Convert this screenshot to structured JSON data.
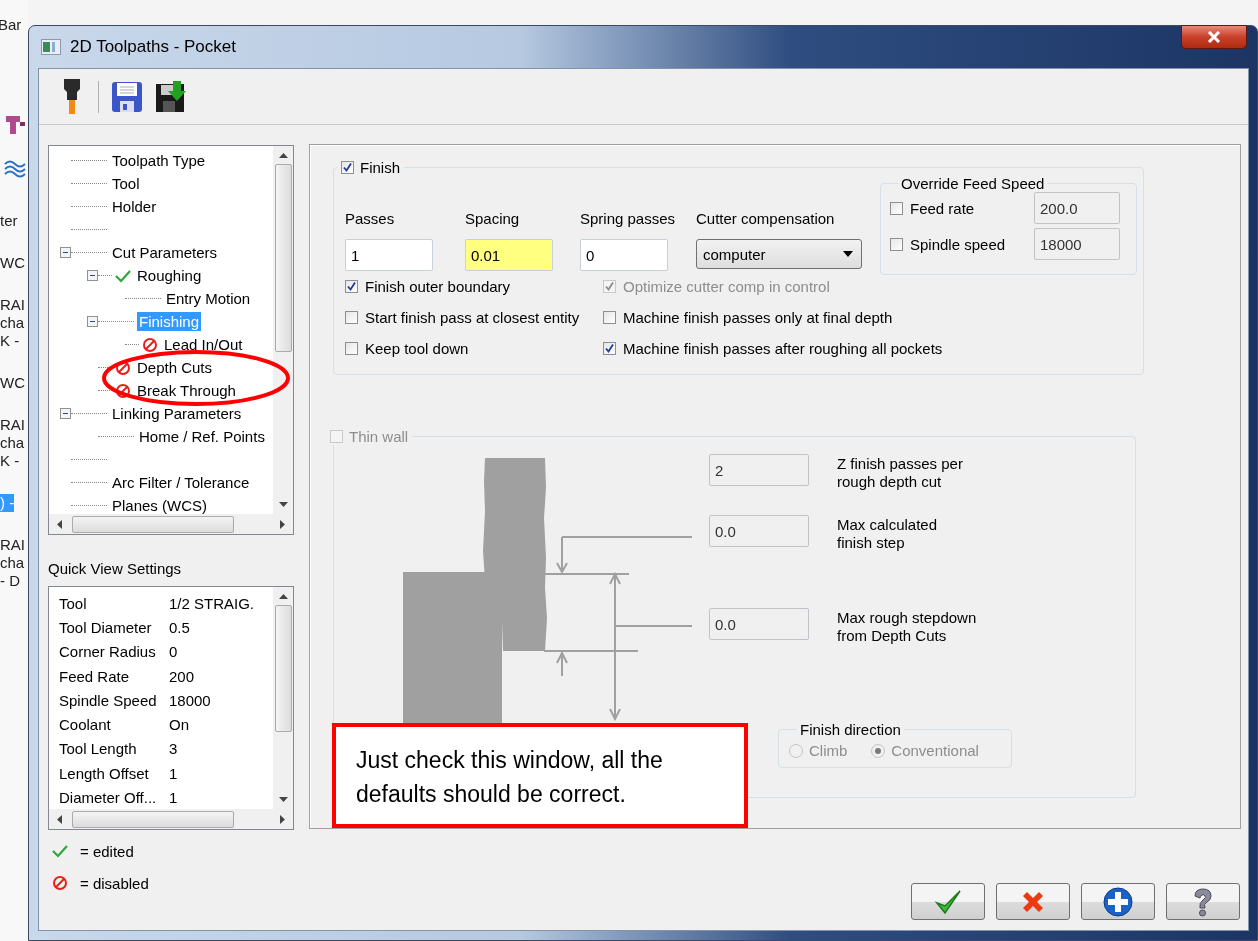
{
  "background_app": {
    "title_fragment": "Bar",
    "groups": [
      {
        "lines": [
          "ter"
        ],
        "selected": false
      },
      {
        "lines": [
          "WC"
        ],
        "selected": false
      },
      {
        "lines": [
          "RAI",
          "cha",
          "K -"
        ],
        "selected": false
      },
      {
        "lines": [
          "WC"
        ],
        "selected": false
      },
      {
        "lines": [
          "RAI",
          "cha",
          "K -"
        ],
        "selected": false
      },
      {
        "lines": [
          ") -"
        ],
        "selected": true
      },
      {
        "lines": [
          "RAI",
          "cha",
          "- D"
        ],
        "selected": false
      }
    ]
  },
  "window": {
    "title": "2D Toolpaths - Pocket"
  },
  "tree": {
    "items": [
      {
        "kind": "node",
        "label": "Toolpath Type",
        "selected": false,
        "edited": false,
        "disabled": false
      },
      {
        "kind": "node",
        "label": "Tool",
        "selected": false,
        "edited": false,
        "disabled": false
      },
      {
        "kind": "node",
        "label": "Holder",
        "selected": false,
        "edited": false,
        "disabled": false
      },
      {
        "kind": "spacer"
      },
      {
        "kind": "node",
        "label": "Cut Parameters",
        "selected": false,
        "edited": false,
        "disabled": false,
        "expanded": true,
        "children": [
          {
            "kind": "node",
            "label": "Roughing",
            "selected": false,
            "edited": true,
            "disabled": false,
            "expanded": true,
            "children": [
              {
                "kind": "node",
                "label": "Entry Motion",
                "selected": false,
                "edited": false,
                "disabled": false
              }
            ]
          },
          {
            "kind": "node",
            "label": "Finishing",
            "selected": true,
            "edited": false,
            "disabled": false,
            "expanded": true,
            "children": [
              {
                "kind": "node",
                "label": "Lead In/Out",
                "selected": false,
                "edited": false,
                "disabled": true
              }
            ]
          },
          {
            "kind": "node",
            "label": "Depth Cuts",
            "selected": false,
            "edited": false,
            "disabled": true
          },
          {
            "kind": "node",
            "label": "Break Through",
            "selected": false,
            "edited": false,
            "disabled": true
          }
        ]
      },
      {
        "kind": "node",
        "label": "Linking Parameters",
        "selected": false,
        "edited": false,
        "disabled": false,
        "expanded": true,
        "children": [
          {
            "kind": "node",
            "label": "Home / Ref. Points",
            "selected": false,
            "edited": false,
            "disabled": false
          }
        ]
      },
      {
        "kind": "spacer"
      },
      {
        "kind": "node",
        "label": "Arc Filter / Tolerance",
        "selected": false,
        "edited": false,
        "disabled": false
      },
      {
        "kind": "node",
        "label": "Planes (WCS)",
        "selected": false,
        "edited": false,
        "disabled": false
      }
    ]
  },
  "quick_view": {
    "title": "Quick View Settings",
    "rows": [
      {
        "label": "Tool",
        "value": "1/2 STRAIG."
      },
      {
        "label": "Tool Diameter",
        "value": "0.5"
      },
      {
        "label": "Corner Radius",
        "value": "0"
      },
      {
        "label": "Feed Rate",
        "value": "200"
      },
      {
        "label": "Spindle Speed",
        "value": "18000"
      },
      {
        "label": "Coolant",
        "value": "On"
      },
      {
        "label": "Tool Length",
        "value": "3"
      },
      {
        "label": "Length Offset",
        "value": "1"
      },
      {
        "label": "Diameter Off...",
        "value": "1"
      }
    ]
  },
  "legend": [
    {
      "kind": "edited",
      "text": "= edited"
    },
    {
      "kind": "disabled",
      "text": "= disabled"
    }
  ],
  "finish": {
    "label": "Finish",
    "checked": true,
    "fields": [
      {
        "label": "Passes",
        "value": "1",
        "highlighted": false
      },
      {
        "label": "Spacing",
        "value": "0.01",
        "highlighted": true
      },
      {
        "label": "Spring passes",
        "value": "0",
        "highlighted": false
      }
    ],
    "cutter_compensation": {
      "label": "Cutter compensation",
      "value": "computer"
    },
    "override": {
      "title": "Override Feed Speed",
      "rows": [
        {
          "label": "Feed rate",
          "checked": false,
          "value": "200.0"
        },
        {
          "label": "Spindle speed",
          "checked": false,
          "value": "18000"
        }
      ]
    },
    "options": [
      {
        "label": "Finish outer boundary",
        "checked": true,
        "disabled": false
      },
      {
        "label": "Optimize cutter comp in control",
        "checked": true,
        "disabled": true
      },
      {
        "label": "Start finish pass at closest entity",
        "checked": false,
        "disabled": false
      },
      {
        "label": "Machine finish passes only at final depth",
        "checked": false,
        "disabled": false
      },
      {
        "label": "Keep tool down",
        "checked": false,
        "disabled": false
      },
      {
        "label": "Machine finish passes after roughing all pockets",
        "checked": true,
        "disabled": false
      }
    ]
  },
  "thin_wall": {
    "label": "Thin wall",
    "checked": false,
    "disabled": true,
    "fields": [
      {
        "value": "2",
        "label_lines": [
          "Z finish passes per",
          "rough depth cut"
        ]
      },
      {
        "value": "0.0",
        "label_lines": [
          "Max calculated",
          "finish step"
        ]
      },
      {
        "value": "0.0",
        "label_lines": [
          "Max rough stepdown",
          "from Depth Cuts"
        ]
      }
    ],
    "finish_direction": {
      "title": "Finish direction",
      "disabled": true,
      "options": [
        {
          "label": "Climb",
          "selected": false
        },
        {
          "label": "Conventional",
          "selected": true
        }
      ]
    }
  },
  "buttons": [
    {
      "kind": "ok"
    },
    {
      "kind": "cancel"
    },
    {
      "kind": "add"
    },
    {
      "kind": "help"
    }
  ],
  "callout": {
    "text": "Just check this window, all the defaults should be correct."
  }
}
